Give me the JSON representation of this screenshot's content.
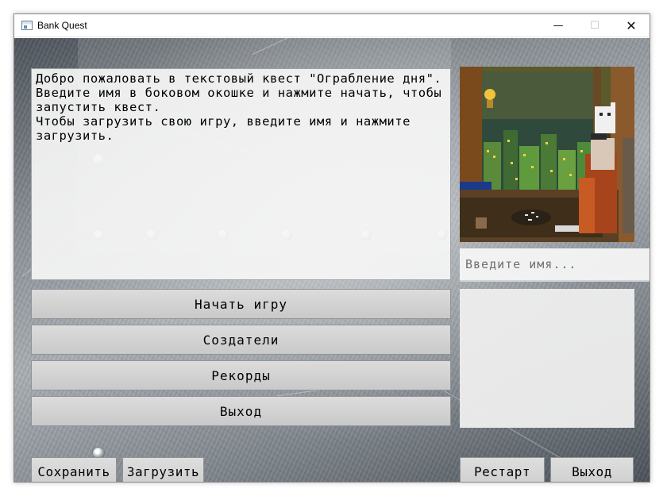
{
  "window": {
    "title": "Bank Quest",
    "controls": {
      "minimize": "—",
      "maximize": "☐",
      "close": "✕"
    }
  },
  "story": {
    "text": "Добро пожаловать в текстовый квест \"Ограбление дня\". Введите имя в боковом окошке и нажмите начать, чтобы запустить квест.\nЧтобы загрузить свою игру, введите имя и нажмите загрузить."
  },
  "name_input": {
    "value": "",
    "placeholder": "Введите имя..."
  },
  "menu": {
    "start": "Начать игру",
    "creators": "Создатели",
    "records": "Рекорды",
    "exit": "Выход"
  },
  "bottom": {
    "save": "Сохранить",
    "load": "Загрузить",
    "restart": "Рестарт",
    "exit": "Выход"
  },
  "colors": {
    "panel": "#f5f5f5",
    "button": "#d4d4d4",
    "metal_dark": "#4a5158",
    "metal_light": "#a7adb2"
  }
}
